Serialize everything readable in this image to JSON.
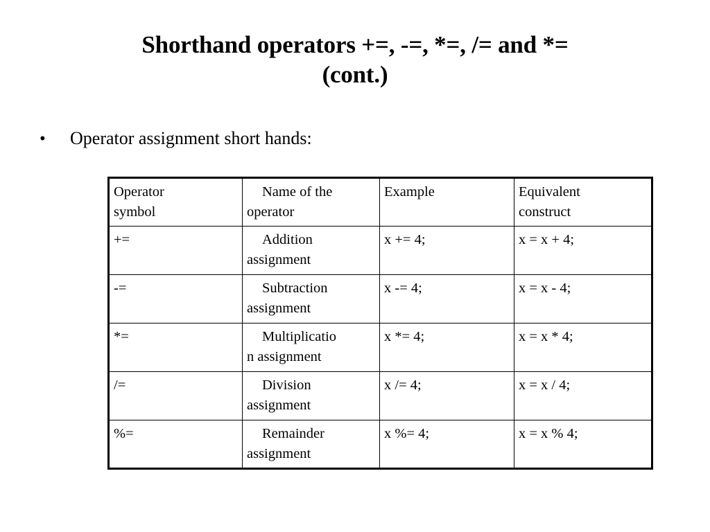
{
  "slide": {
    "title": "Shorthand operators +=, -=, *=, /= and *= (cont.)",
    "title_line1": "Shorthand operators +=, -=, *=, /= and *=",
    "title_line2": "(cont.)",
    "bullet_marker": "•",
    "bullet_text": "Operator assignment short hands:"
  },
  "colors": {
    "text": "#000000",
    "accent_red": "#EE0000",
    "background": "#FFFFFF",
    "table_border": "#000000"
  },
  "table": {
    "headers": [
      {
        "line1": "Operator",
        "line2": "symbol"
      },
      {
        "line1": "Name of the",
        "line2": "operator"
      },
      {
        "line1": "Example",
        "line2": ""
      },
      {
        "line1": "Equivalent",
        "line2": "construct"
      }
    ],
    "rows": [
      {
        "symbol": "+=",
        "name_line1": "Addition",
        "name_line2": "assignment",
        "example": "x += 4;",
        "equivalent": "x = x + 4;"
      },
      {
        "symbol": "-=",
        "name_line1": "Subtraction",
        "name_line2": "assignment",
        "example": "x -= 4;",
        "equivalent": "x = x - 4;"
      },
      {
        "symbol": "*=",
        "name_line1": "Multiplicatio",
        "name_line2": "n assignment",
        "example": "x *= 4;",
        "equivalent": "x = x * 4;"
      },
      {
        "symbol": "/=",
        "name_line1": "Division",
        "name_line2": "assignment",
        "example": "x /= 4;",
        "equivalent": "x = x / 4;"
      },
      {
        "symbol": "%=",
        "name_line1": "Remainder",
        "name_line2": "assignment",
        "example": "x %= 4;",
        "equivalent": "x = x % 4;"
      }
    ]
  }
}
